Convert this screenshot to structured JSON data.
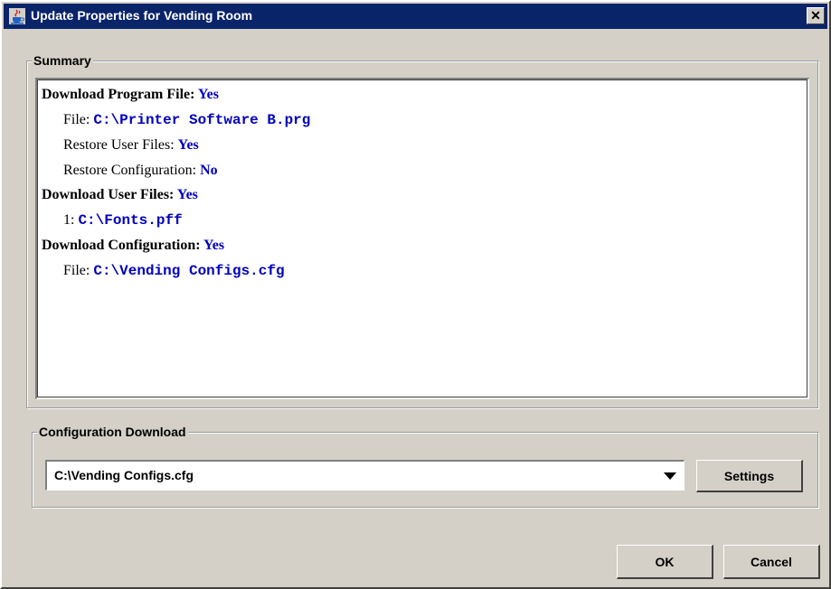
{
  "window": {
    "title": "Update Properties for Vending Room",
    "close_glyph": "✕",
    "icon": "java-cup-icon",
    "titlebar_color": "#0a246a"
  },
  "summary": {
    "label": "Summary",
    "lines": {
      "download_program": {
        "label": "Download Program File:",
        "value": "Yes"
      },
      "program_file": {
        "label": "File:",
        "value": "C:\\Printer Software B.prg"
      },
      "restore_user_files": {
        "label": "Restore User Files:",
        "value": "Yes"
      },
      "restore_configuration": {
        "label": "Restore Configuration:",
        "value": "No"
      },
      "download_user_files": {
        "label": "Download User Files:",
        "value": "Yes"
      },
      "user_file_1": {
        "label": "1:",
        "value": "C:\\Fonts.pff"
      },
      "download_configuration": {
        "label": "Download Configuration:",
        "value": "Yes"
      },
      "configuration_file": {
        "label": "File:",
        "value": "C:\\Vending Configs.cfg"
      }
    },
    "value_color": "#0000c0"
  },
  "configuration_download": {
    "label": "Configuration Download",
    "selected": "C:\\Vending Configs.cfg",
    "settings_label": "Settings"
  },
  "footer": {
    "ok_label": "OK",
    "cancel_label": "Cancel"
  }
}
